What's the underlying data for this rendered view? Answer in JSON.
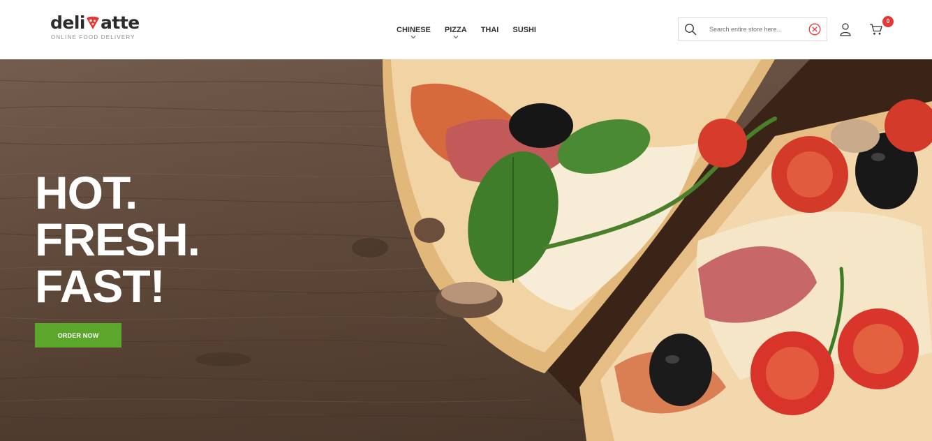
{
  "header": {
    "logo": {
      "word_left": "deli",
      "word_right": "atte",
      "tagline": "ONLINE FOOD DELIVERY",
      "mark_icon": "pizza-slice-icon",
      "accent_color": "#e53935"
    },
    "nav": [
      {
        "label": "CHINESE",
        "has_dropdown": true
      },
      {
        "label": "PIZZA",
        "has_dropdown": true
      },
      {
        "label": "THAI",
        "has_dropdown": false
      },
      {
        "label": "SUSHI",
        "has_dropdown": false
      }
    ],
    "search": {
      "placeholder": "Search entire store here...",
      "value": "",
      "icon": "search-icon",
      "clear_icon": "clear-circle-icon"
    },
    "account_icon": "user-icon",
    "cart": {
      "icon": "cart-icon",
      "count": "0",
      "badge_color": "#e53935"
    }
  },
  "hero": {
    "headline": [
      "HOT.",
      "FRESH.",
      "FAST!"
    ],
    "cta_label": "ORDER NOW",
    "cta_color": "#5ba72b",
    "image": "pizza-on-wooden-table"
  }
}
